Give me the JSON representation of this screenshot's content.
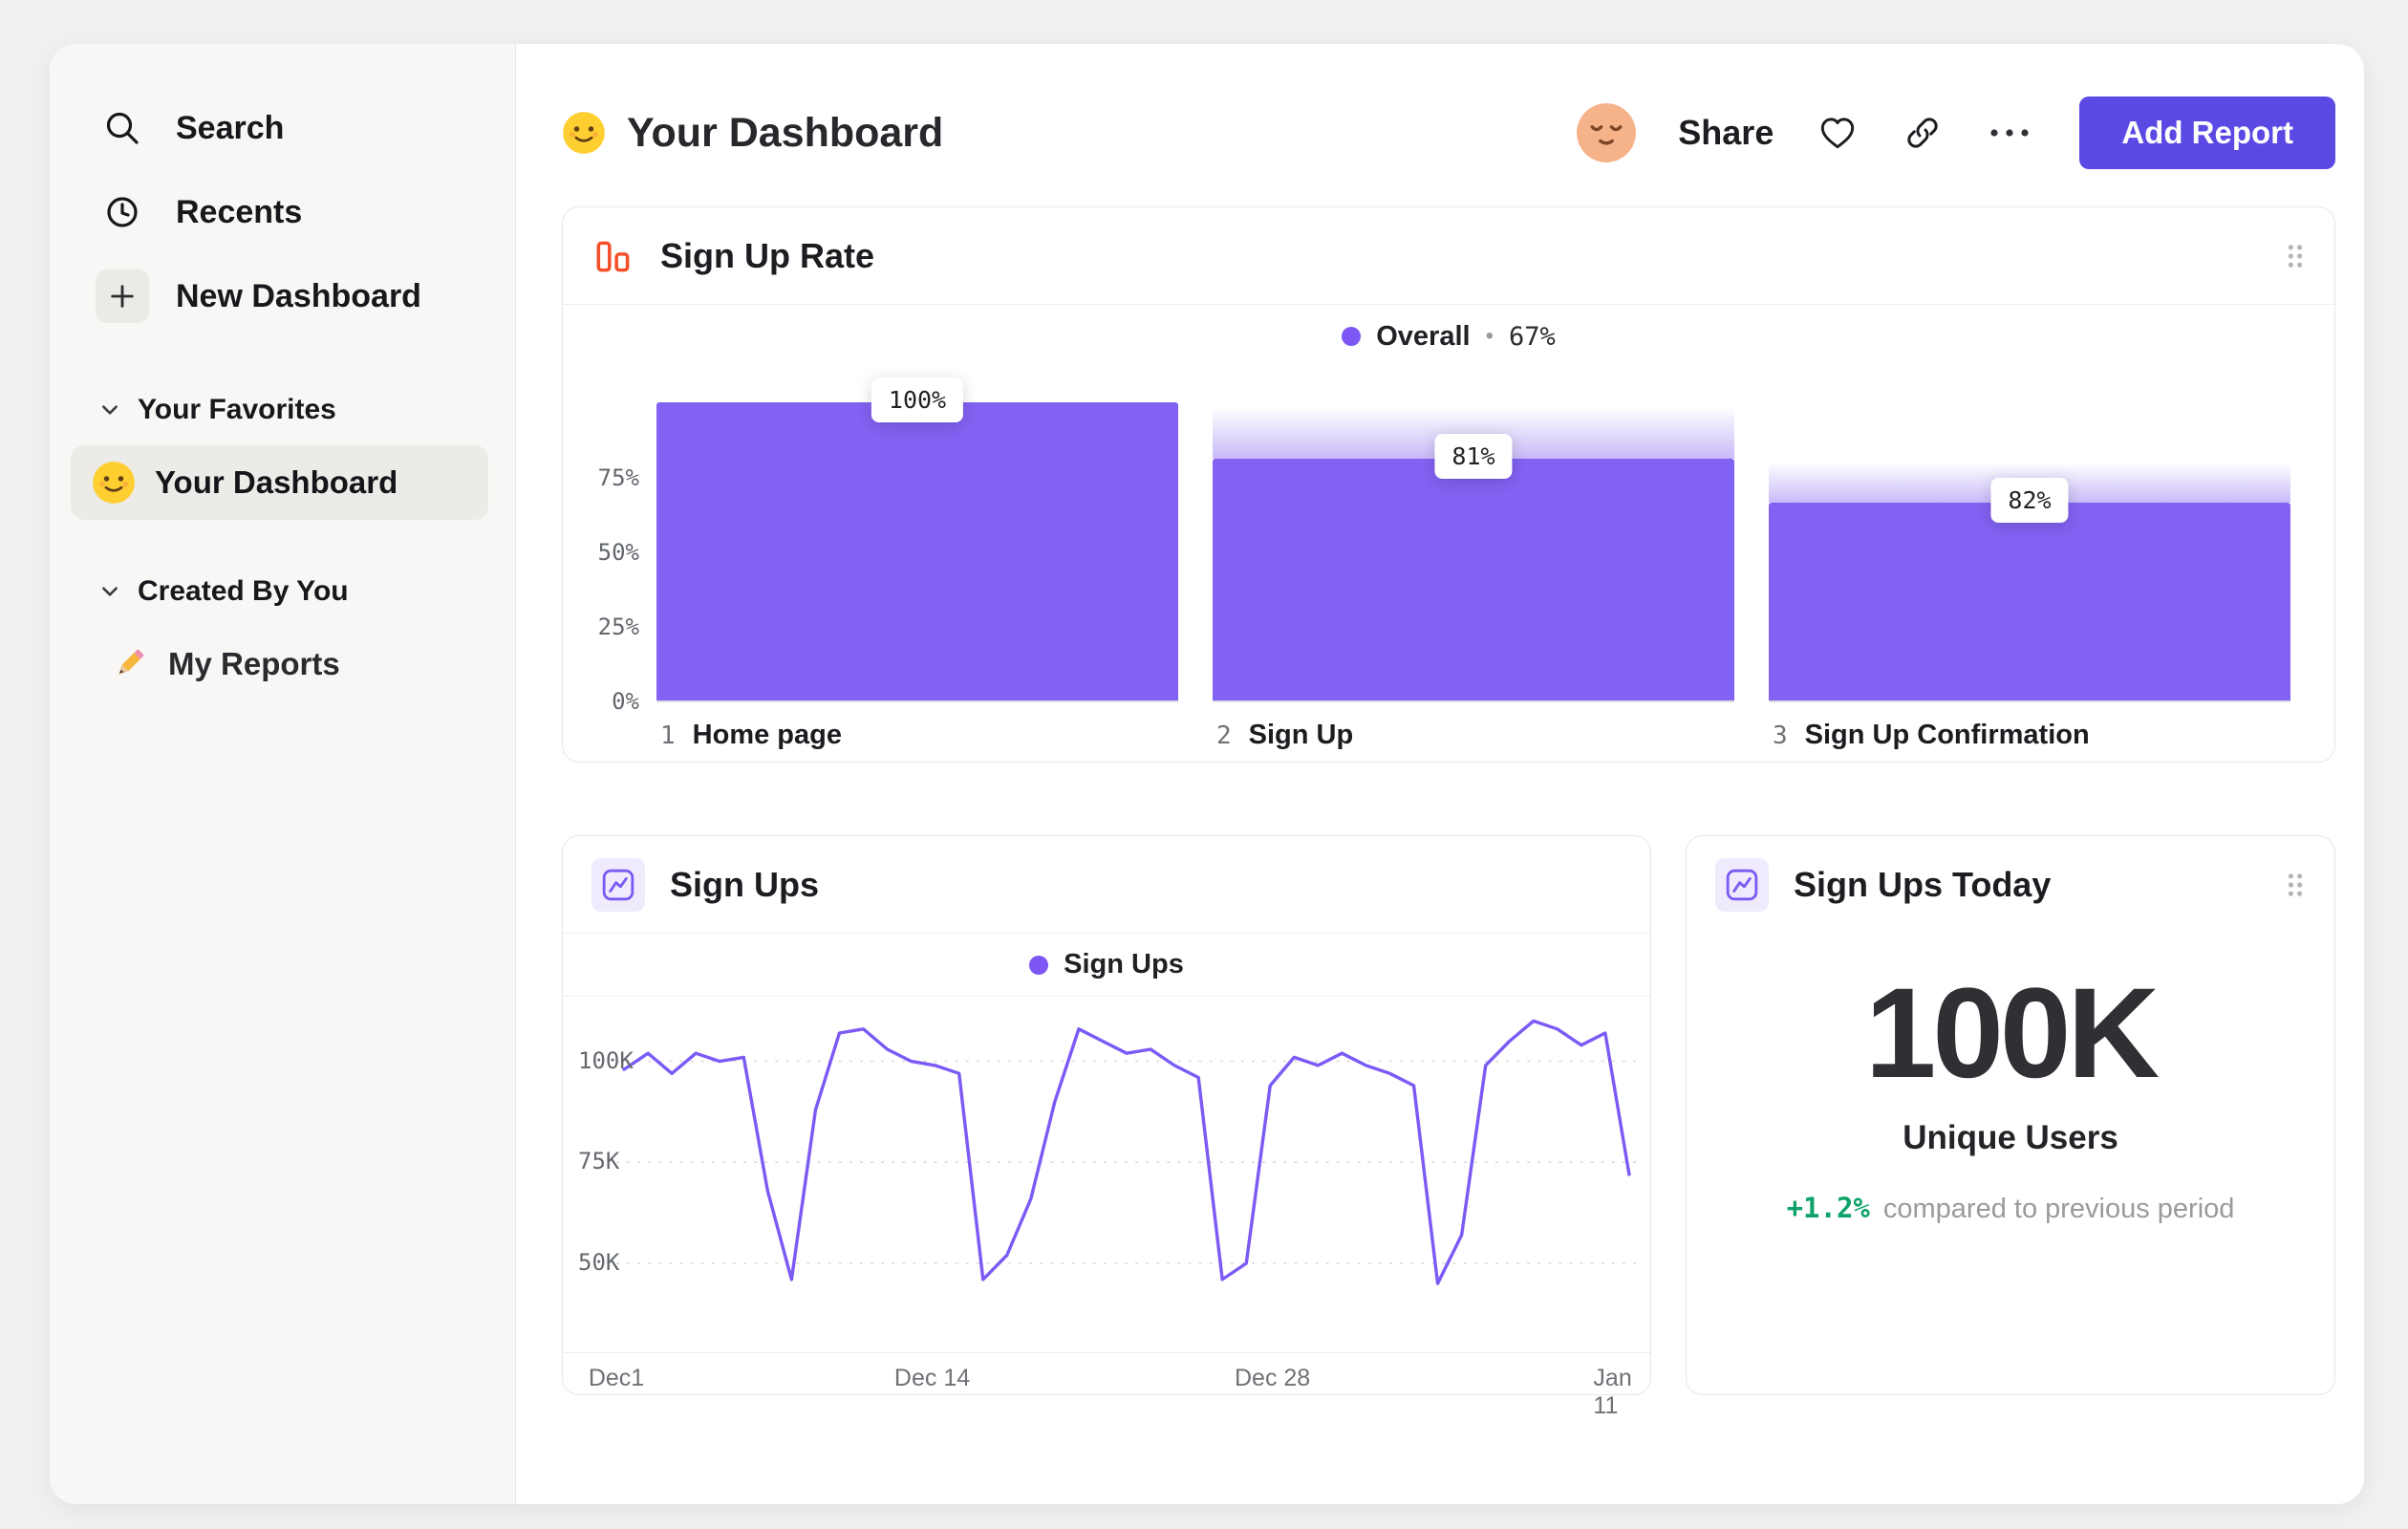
{
  "colors": {
    "accent": "#7b5af5",
    "bar_fill": "#8262f2",
    "gradient_bottom": "#c9baf8",
    "button": "#5b49e4",
    "orange_icon": "#f4502a",
    "green": "#0fa36b",
    "avatar_bg": "#f6b289"
  },
  "sidebar": {
    "nav": [
      {
        "label": "Search",
        "icon": "search-icon"
      },
      {
        "label": "Recents",
        "icon": "clock-icon"
      },
      {
        "label": "New Dashboard",
        "icon": "plus-icon"
      }
    ],
    "sections": [
      {
        "title": "Your Favorites",
        "items": [
          {
            "label": "Your Dashboard",
            "icon": "smiley-emoji",
            "active": true
          }
        ]
      },
      {
        "title": "Created By You",
        "items": [
          {
            "label": "My Reports",
            "icon": "pencil-emoji",
            "active": false
          }
        ]
      }
    ]
  },
  "header": {
    "title": "Your Dashboard",
    "share": "Share",
    "add_report": "Add Report"
  },
  "funnel_card": {
    "title": "Sign Up Rate",
    "legend_label": "Overall",
    "legend_sep": "•",
    "legend_value": "67%"
  },
  "line_card": {
    "title": "Sign Ups",
    "legend_label": "Sign Ups"
  },
  "stat_card": {
    "title": "Sign Ups Today",
    "value": "100K",
    "unit_label": "Unique Users",
    "delta": "+1.2%",
    "delta_text": "compared to previous period"
  },
  "chart_data": [
    {
      "type": "bar",
      "subtype": "funnel",
      "title": "Sign Up Rate",
      "legend": {
        "name": "Overall",
        "value_pct": 67
      },
      "y_ticks": [
        "75%",
        "50%",
        "25%",
        "0%"
      ],
      "ylim": [
        0,
        100
      ],
      "steps": [
        {
          "index": 1,
          "label": "Home page",
          "conversion_label": "100%",
          "conversion_pct": 100,
          "absolute_pct": 100,
          "previous_absolute_pct": 100
        },
        {
          "index": 2,
          "label": "Sign Up",
          "conversion_label": "81%",
          "conversion_pct": 81,
          "absolute_pct": 81,
          "previous_absolute_pct": 100
        },
        {
          "index": 3,
          "label": "Sign Up Confirmation",
          "conversion_label": "82%",
          "conversion_pct": 82,
          "absolute_pct": 66.4,
          "previous_absolute_pct": 81
        }
      ]
    },
    {
      "type": "line",
      "title": "Sign Ups",
      "legend_position": "top-center",
      "grid": "dashed-horizontal",
      "series": [
        {
          "name": "Sign Ups",
          "unit": "K",
          "values": [
            98,
            102,
            97,
            102,
            100,
            101,
            68,
            46,
            88,
            107,
            108,
            103,
            100,
            99,
            97,
            46,
            52,
            66,
            90,
            108,
            105,
            102,
            103,
            99,
            96,
            46,
            50,
            94,
            101,
            99,
            102,
            99,
            97,
            94,
            45,
            57,
            99,
            105,
            110,
            108,
            104,
            107,
            72
          ]
        }
      ],
      "x_ticks": [
        {
          "label": "Dec1",
          "index": 0
        },
        {
          "label": "Dec 14",
          "index": 13
        },
        {
          "label": "Dec 28",
          "index": 27
        },
        {
          "label": "Jan 11",
          "index": 41
        }
      ],
      "y_ticks": [
        {
          "label": "100K",
          "value": 100
        },
        {
          "label": "75K",
          "value": 75
        },
        {
          "label": "50K",
          "value": 50
        }
      ],
      "ylim": [
        28,
        116
      ]
    },
    {
      "type": "stat",
      "title": "Sign Ups Today",
      "value": "100K",
      "label": "Unique Users",
      "delta_pct": 1.2,
      "delta_label": "+1.2%",
      "comparison": "compared to previous period"
    }
  ]
}
